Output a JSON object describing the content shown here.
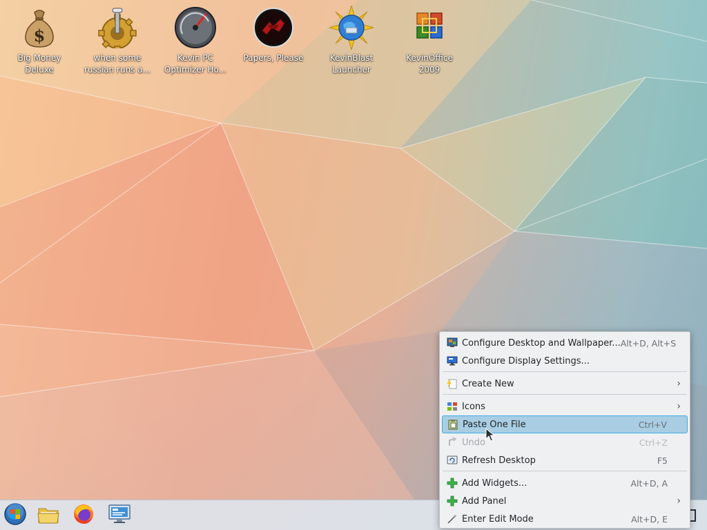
{
  "desktop": {
    "icons": [
      {
        "label": "Big Money\nDeluxe",
        "icon": "money-bag-icon"
      },
      {
        "label": "when some\nrussian runs a...",
        "icon": "gear-joystick-icon"
      },
      {
        "label": "Kevin PC\nOptimizer Ho...",
        "icon": "speedometer-icon"
      },
      {
        "label": "Papers, Please",
        "icon": "papers-please-emblem-icon"
      },
      {
        "label": "KevinBlast\nLauncher",
        "icon": "sun-globe-icon"
      },
      {
        "label": "KevinOffice\n2009",
        "icon": "office-logo-icon"
      }
    ]
  },
  "taskbar": {
    "buttons": [
      {
        "name": "start-menu-button",
        "icon": "windows-orb-icon"
      },
      {
        "name": "file-manager-button",
        "icon": "folder-icon"
      },
      {
        "name": "firefox-button",
        "icon": "firefox-icon"
      },
      {
        "name": "system-settings-button",
        "icon": "monitor-settings-icon"
      }
    ]
  },
  "context_menu": {
    "items": [
      {
        "label": "Configure Desktop and Wallpaper...",
        "shortcut": "Alt+D, Alt+S",
        "icon": "desktop-config-icon",
        "submenu": false,
        "disabled": false,
        "highlighted": false
      },
      {
        "label": "Configure Display Settings...",
        "shortcut": "",
        "icon": "display-icon",
        "submenu": false,
        "disabled": false,
        "highlighted": false
      },
      {
        "label": "Create New",
        "shortcut": "",
        "icon": "new-document-icon",
        "submenu": true,
        "disabled": false,
        "highlighted": false
      },
      {
        "label": "Icons",
        "shortcut": "",
        "icon": "icons-grid-icon",
        "submenu": true,
        "disabled": false,
        "highlighted": false
      },
      {
        "label": "Paste One File",
        "shortcut": "Ctrl+V",
        "icon": "paste-icon",
        "submenu": false,
        "disabled": false,
        "highlighted": true
      },
      {
        "label": "Undo",
        "shortcut": "Ctrl+Z",
        "icon": "undo-icon",
        "submenu": false,
        "disabled": true,
        "highlighted": false
      },
      {
        "label": "Refresh Desktop",
        "shortcut": "F5",
        "icon": "refresh-icon",
        "submenu": false,
        "disabled": false,
        "highlighted": false
      },
      {
        "label": "Add Widgets...",
        "shortcut": "Alt+D, A",
        "icon": "add-icon",
        "submenu": false,
        "disabled": false,
        "highlighted": false
      },
      {
        "label": "Add Panel",
        "shortcut": "",
        "icon": "add-icon",
        "submenu": true,
        "disabled": false,
        "highlighted": false
      },
      {
        "label": "Enter Edit Mode",
        "shortcut": "Alt+D, E",
        "icon": "edit-mode-icon",
        "submenu": false,
        "disabled": false,
        "highlighted": false
      }
    ],
    "submenu_arrow": "›"
  },
  "colors": {
    "menu_bg": "#eff0f1",
    "highlight_bg": "#a9cde3",
    "highlight_border": "#3daee9",
    "disabled_text": "#a5a8ab"
  }
}
